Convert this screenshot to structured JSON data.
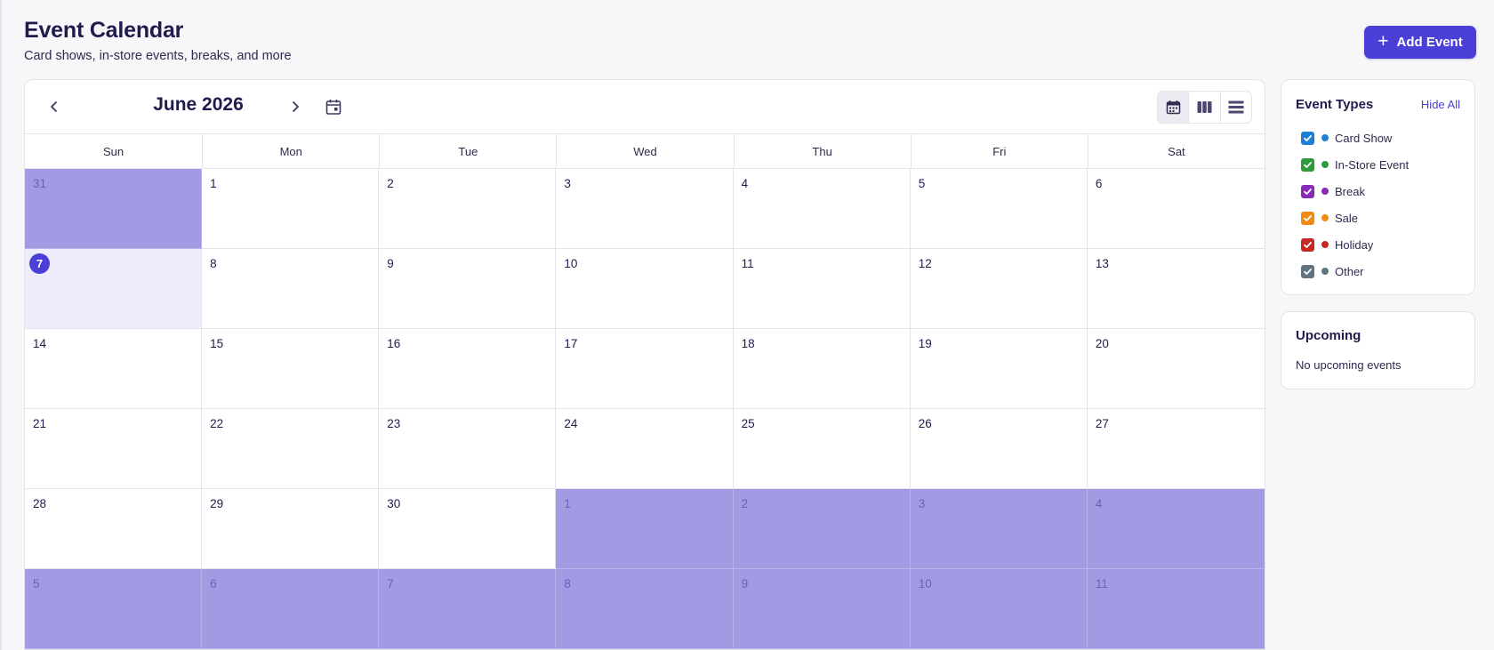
{
  "header": {
    "title": "Event Calendar",
    "subtitle": "Card shows, in-store events, breaks, and more",
    "add_event_label": "Add Event"
  },
  "calendar": {
    "month_label": "June 2026",
    "weekdays": [
      "Sun",
      "Mon",
      "Tue",
      "Wed",
      "Thu",
      "Fri",
      "Sat"
    ],
    "active_view": "month",
    "views": [
      "month",
      "week",
      "list"
    ],
    "weeks": [
      [
        {
          "d": "31",
          "other": true
        },
        {
          "d": "1"
        },
        {
          "d": "2"
        },
        {
          "d": "3"
        },
        {
          "d": "4"
        },
        {
          "d": "5"
        },
        {
          "d": "6"
        }
      ],
      [
        {
          "d": "7",
          "today": true
        },
        {
          "d": "8"
        },
        {
          "d": "9"
        },
        {
          "d": "10"
        },
        {
          "d": "11"
        },
        {
          "d": "12"
        },
        {
          "d": "13"
        }
      ],
      [
        {
          "d": "14"
        },
        {
          "d": "15"
        },
        {
          "d": "16"
        },
        {
          "d": "17"
        },
        {
          "d": "18"
        },
        {
          "d": "19"
        },
        {
          "d": "20"
        }
      ],
      [
        {
          "d": "21"
        },
        {
          "d": "22"
        },
        {
          "d": "23"
        },
        {
          "d": "24"
        },
        {
          "d": "25"
        },
        {
          "d": "26"
        },
        {
          "d": "27"
        }
      ],
      [
        {
          "d": "28"
        },
        {
          "d": "29"
        },
        {
          "d": "30"
        },
        {
          "d": "1",
          "other": true
        },
        {
          "d": "2",
          "other": true
        },
        {
          "d": "3",
          "other": true
        },
        {
          "d": "4",
          "other": true
        }
      ],
      [
        {
          "d": "5",
          "other": true
        },
        {
          "d": "6",
          "other": true
        },
        {
          "d": "7",
          "other": true
        },
        {
          "d": "8",
          "other": true
        },
        {
          "d": "9",
          "other": true
        },
        {
          "d": "10",
          "other": true
        },
        {
          "d": "11",
          "other": true
        }
      ]
    ]
  },
  "event_types": {
    "title": "Event Types",
    "hide_all_label": "Hide All",
    "items": [
      {
        "label": "Card Show",
        "color": "#1e7fd6",
        "checked": true
      },
      {
        "label": "In-Store Event",
        "color": "#2e9a3e",
        "checked": true
      },
      {
        "label": "Break",
        "color": "#8a2bb8",
        "checked": true
      },
      {
        "label": "Sale",
        "color": "#f08a12",
        "checked": true
      },
      {
        "label": "Holiday",
        "color": "#c62828",
        "checked": true
      },
      {
        "label": "Other",
        "color": "#5f7480",
        "checked": true
      }
    ]
  },
  "upcoming": {
    "title": "Upcoming",
    "empty_text": "No upcoming events"
  },
  "colors": {
    "accent": "#4a3fd6",
    "other_month_fill": "#a29ae3",
    "today_fill": "#efedfb"
  }
}
